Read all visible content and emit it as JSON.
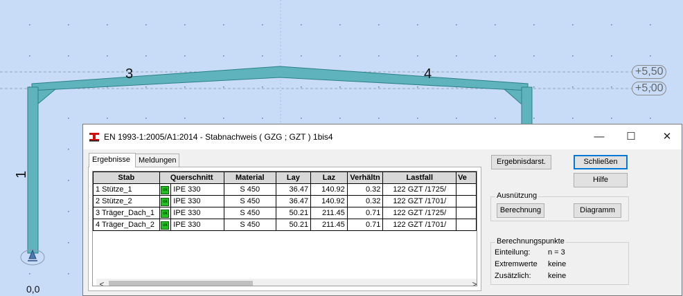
{
  "viewport": {
    "member_labels": [
      "3",
      "4",
      "1"
    ],
    "levels": [
      "+5,50",
      "+5,00"
    ],
    "origin": "0,0"
  },
  "dialog": {
    "title": "EN 1993-1:2005/A1:2014 - Stabnachweis ( GZG ; GZT ) 1bis4",
    "window_buttons": [
      "—",
      "☐",
      "✕"
    ],
    "tabs": [
      "Ergebnisse",
      "Meldungen"
    ],
    "table": {
      "columns": [
        "Stab",
        "Querschnitt",
        "Material",
        "Lay",
        "Laz",
        "Verhältn",
        "Lastfall",
        "Ve"
      ],
      "rows": [
        {
          "stab": "1  Stütze_1",
          "status": "ok",
          "querschnitt": "IPE 330",
          "material": "S 450",
          "lay": "36.47",
          "laz": "140.92",
          "verh": "0.32",
          "lastfall": "122 GZT /1725/",
          "ve": ""
        },
        {
          "stab": "2  Stütze_2",
          "status": "ok",
          "querschnitt": "IPE 330",
          "material": "S 450",
          "lay": "36.47",
          "laz": "140.92",
          "verh": "0.32",
          "lastfall": "122 GZT /1701/",
          "ve": ""
        },
        {
          "stab": "3  Träger_Dach_1",
          "status": "ok",
          "querschnitt": "IPE 330",
          "material": "S 450",
          "lay": "50.21",
          "laz": "211.45",
          "verh": "0.71",
          "lastfall": "122 GZT /1725/",
          "ve": ""
        },
        {
          "stab": "4  Träger_Dach_2",
          "status": "ok",
          "querschnitt": "IPE 330",
          "material": "S 450",
          "lay": "50.21",
          "laz": "211.45",
          "verh": "0.71",
          "lastfall": "122 GZT /1701/",
          "ve": ""
        }
      ]
    },
    "buttons": {
      "ergebnisdarst": "Ergebnisdarst.",
      "schliessen": "Schließen",
      "hilfe": "Hilfe",
      "berechnung": "Berechnung",
      "diagramm": "Diagramm"
    },
    "ausnutzung": {
      "title": "Ausnützung"
    },
    "berechnungspunkte": {
      "title": "Berechnungspunkte",
      "items": [
        {
          "label": "Einteilung:",
          "value": "n = 3"
        },
        {
          "label": "Extremwerte",
          "value": "keine"
        },
        {
          "label": "Zusätzlich:",
          "value": "keine"
        }
      ]
    },
    "scroll_left": "<",
    "scroll_right": ">"
  },
  "colors": {
    "background": "#c8dcf8",
    "member_fill": "#5fb3bd",
    "member_stroke": "#2a7f88",
    "ok_green": "#22c022",
    "accent": "#0078d7"
  }
}
